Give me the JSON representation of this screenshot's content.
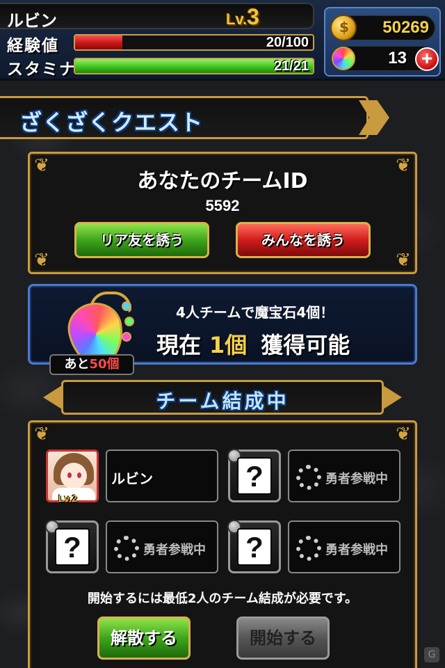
{
  "player": {
    "name": "ルビン",
    "level_prefix": "Lv.",
    "level_value": "3",
    "exp_label": "経験値",
    "exp_value": "20/100",
    "exp_fraction": 0.2,
    "stamina_label": "スタミナ",
    "stamina_value": "21/21",
    "stamina_fraction": 1.0
  },
  "currency": {
    "coins": "50269",
    "gems": "13",
    "plus_label": "+"
  },
  "quest": {
    "title": "ざくざくクエスト"
  },
  "team_id": {
    "title": "あなたのチームID",
    "value": "5592",
    "invite_friends_label": "リア友を誘う",
    "invite_everyone_label": "みんなを誘う"
  },
  "reward": {
    "line1": "4人チームで魔宝石4個！",
    "current_label": "現在",
    "current_count": "1個",
    "obtainable_label": "獲得可能",
    "remain_prefix": "あと",
    "remain_count": "50個"
  },
  "team_forming": {
    "title": "チーム結成中",
    "member_name": "ルビン",
    "member_level": "Lv.2",
    "question_mark": "?",
    "waiting_label": "勇者参戦中",
    "requirement": "開始するには最低2人のチーム結成が必要です。",
    "disband_label": "解散する",
    "start_label": "開始する"
  },
  "colors": {
    "accent_gold": "#c99a3e",
    "exp_bar": "#c51616",
    "stamina_bar": "#3ec41d",
    "coin_text": "#f5d24a"
  },
  "icons": [
    "coin-icon",
    "gem-icon",
    "plus-icon",
    "gem-reward-icon",
    "spinner-icon",
    "question-icon",
    "watermark-icon"
  ]
}
